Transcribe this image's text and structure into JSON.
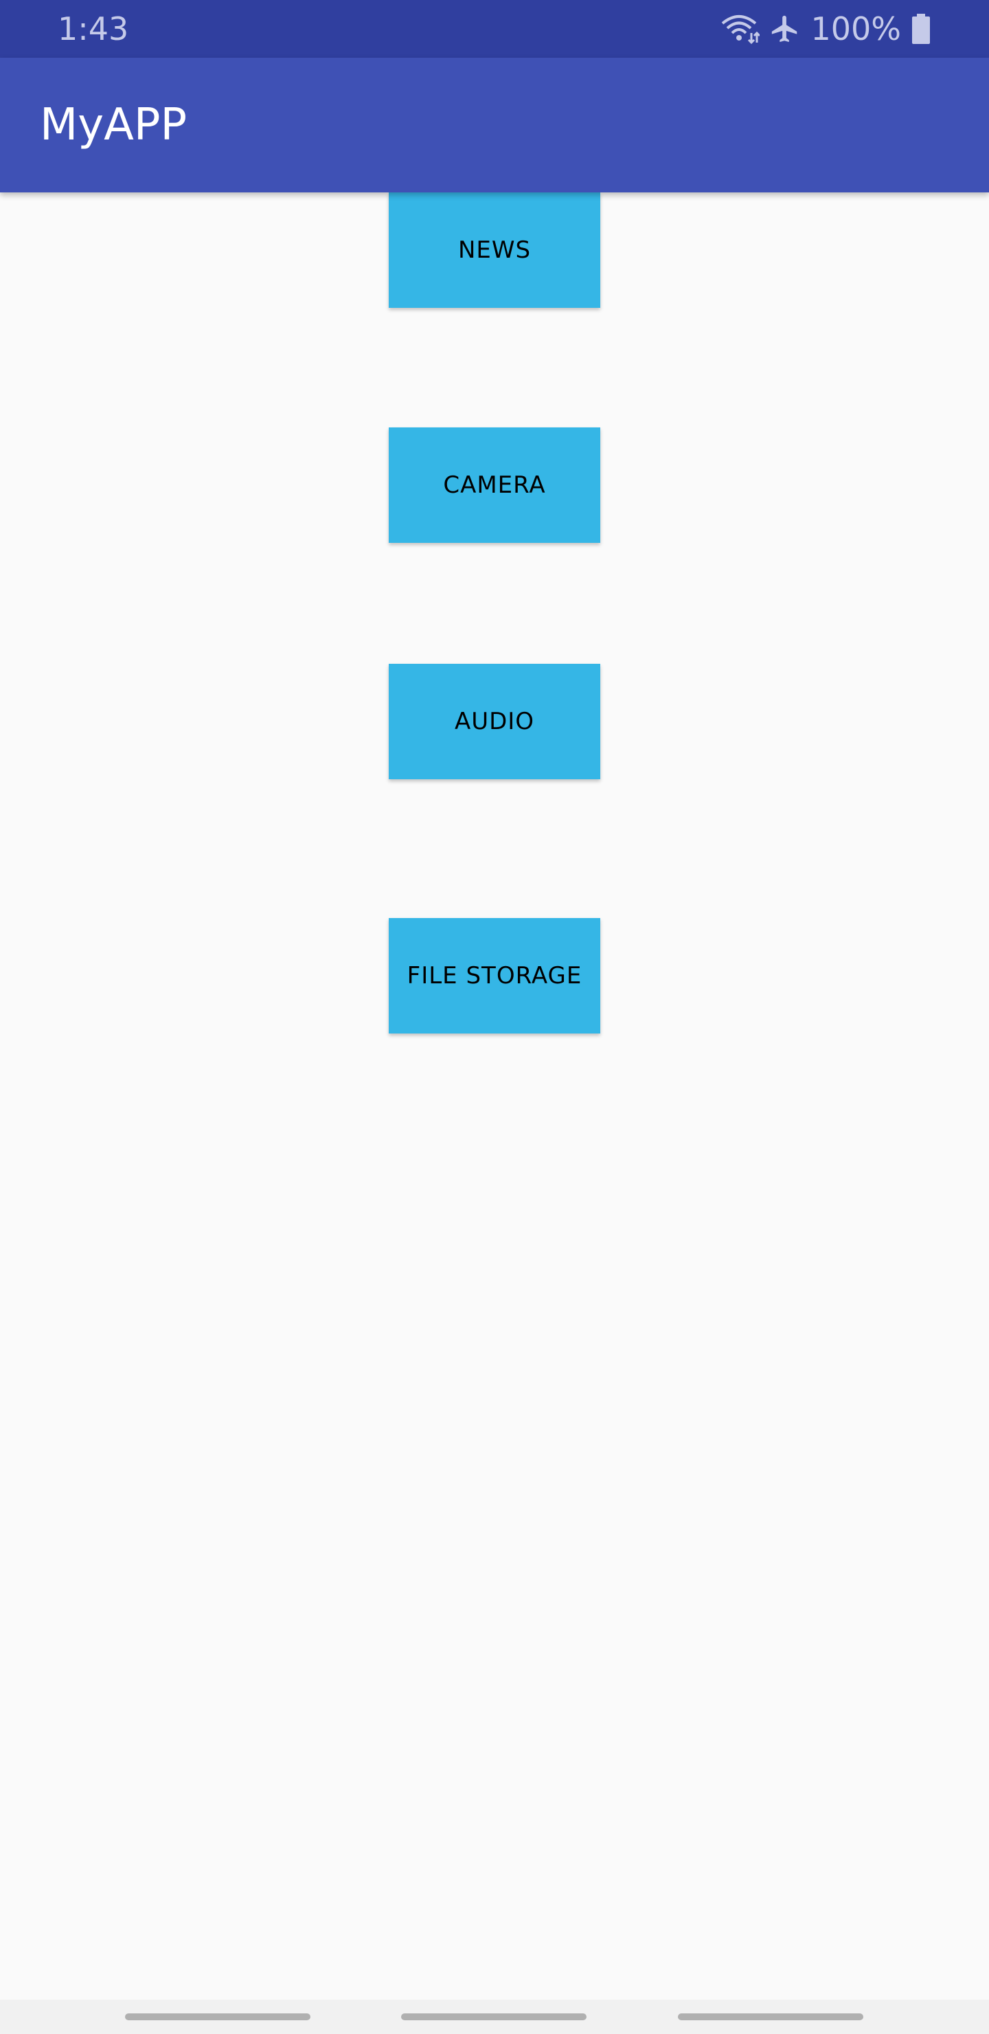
{
  "status_bar": {
    "time": "1:43",
    "battery": "100%",
    "icons": [
      "wifi-icon",
      "airplane-icon",
      "battery-icon"
    ],
    "color_bg": "#303f9f",
    "color_fg": "#c5cae9"
  },
  "app_bar": {
    "title": "MyAPP",
    "color_bg": "#3f51b5"
  },
  "buttons": [
    {
      "label": "NEWS"
    },
    {
      "label": "CAMERA"
    },
    {
      "label": "AUDIO"
    },
    {
      "label": "FILE STORAGE"
    }
  ],
  "colors": {
    "button_bg": "#35b6e6",
    "page_bg": "#fafafa"
  }
}
